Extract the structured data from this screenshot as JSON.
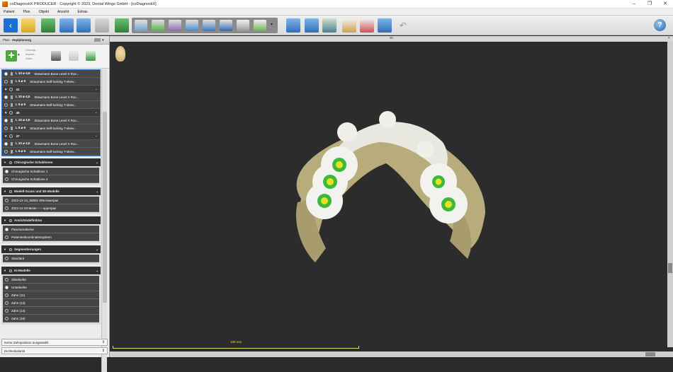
{
  "window": {
    "title": "coDiagnostiX PRODUCER - Copyright © 2023, Dental Wings GmbH - [coDiagnostiX]"
  },
  "menu": [
    "Patient",
    "Plan",
    "Objekt",
    "Ansicht",
    "Extras"
  ],
  "panel": {
    "header_prefix": "Plan:",
    "header_title": "Implplanung",
    "tools": [
      "Chirurgi...",
      "Implan...",
      "Zahn..."
    ],
    "groups": [
      {
        "rows": [
          {
            "val": "L 10  ⌀ 4,5",
            "text": "Straumann Bone Level X Rox...",
            "on": true
          },
          {
            "val": "L 5  ⌀ 5",
            "text": "Straumann Self-locking T-sleev...",
            "on": false
          }
        ]
      },
      {
        "label": "41",
        "rows": [
          {
            "val": "L 10  ⌀ 4,5",
            "text": "Straumann Bone Level X Rox...",
            "on": false
          },
          {
            "val": "L 5  ⌀ 5",
            "text": "Straumann Self-locking T-sleev...",
            "on": false
          }
        ]
      },
      {
        "label": "46",
        "rows": [
          {
            "val": "L 10  ⌀ 4,5",
            "text": "Straumann Bone Level X Rox...",
            "on": false
          },
          {
            "val": "L 5  ⌀ 5",
            "text": "Straumann Self-locking T-sleev...",
            "on": false
          }
        ]
      },
      {
        "label": "47",
        "rows": [
          {
            "val": "L 10  ⌀ 4,5",
            "text": "Straumann Bone Level X Rox...",
            "on": false
          },
          {
            "val": "L 5  ⌀ 5",
            "text": "Straumann Self-locking T-sleev...",
            "on": false
          }
        ]
      }
    ],
    "sections": [
      {
        "title": "Chirurgische Schablonen",
        "items": [
          "Chirurgische Schablone 1",
          "Chirurgische Schablone 2"
        ]
      },
      {
        "title": "Modell-Scans und 3D-Modelle",
        "items": [
          "2023-12-13_00001-006-lowerjaw",
          "2023-12-20-Meier------upperjaw"
        ]
      },
      {
        "title": "Ansichtsdefinition",
        "items": [
          "Panoramakurve",
          "Patientenkoordinatensystem"
        ]
      },
      {
        "title": "Segmentierungen",
        "items": [
          "Standard"
        ]
      },
      {
        "title": "KI-Modelle",
        "items": [
          "Oberkiefer",
          "Unterkiefer",
          "Zahn (11)",
          "Zahn (13)",
          "Zahn (14)",
          "Zahn (15)"
        ]
      }
    ],
    "combo1": "Keine Zahnposition ausgewählt",
    "combo2": "Dichteskala/sb"
  },
  "viewport": {
    "label": "3D",
    "scale_label": "100 mm"
  },
  "colors": {
    "accent": "#2c78c8",
    "implant_ring": "#3cb83c",
    "implant_core": "#e8e020",
    "bone": "#c8b888"
  }
}
